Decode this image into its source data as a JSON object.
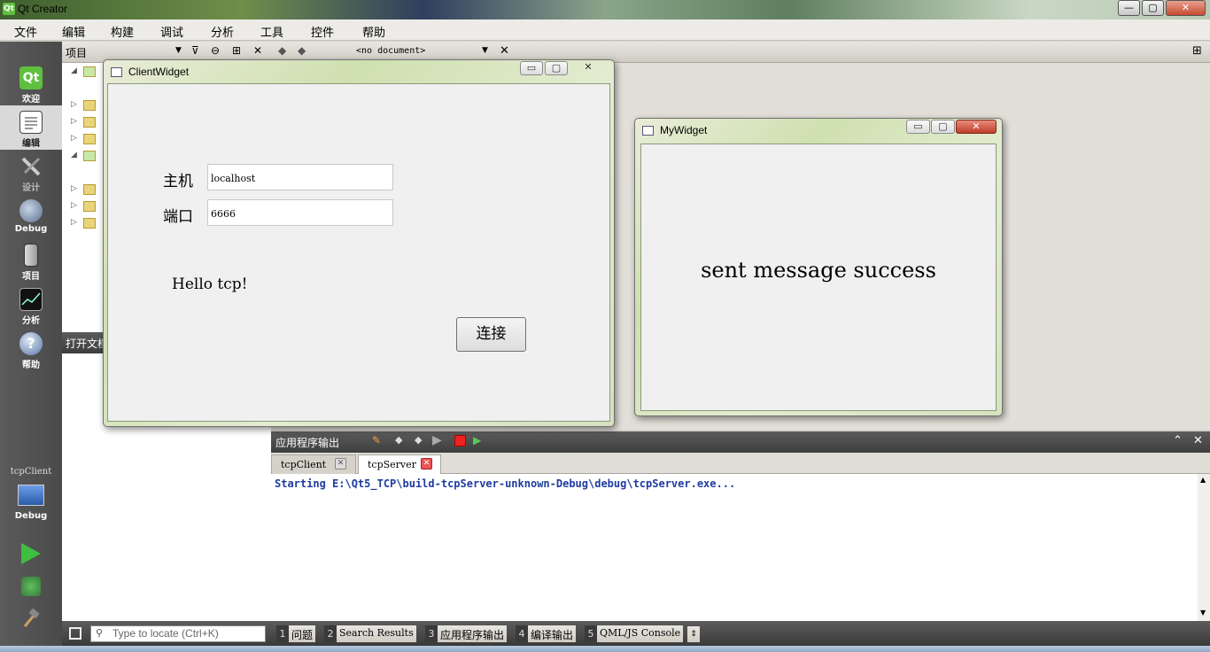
{
  "window": {
    "title": "Qt Creator",
    "minimize": "—",
    "maximize": "▢",
    "close": "✕"
  },
  "menubar": [
    "文件",
    "编辑",
    "构建",
    "调试",
    "分析",
    "工具",
    "控件",
    "帮助"
  ],
  "modes": [
    {
      "label": "欢迎",
      "icon": "qt-logo-icon"
    },
    {
      "label": "编辑",
      "icon": "edit-document-icon"
    },
    {
      "label": "设计",
      "icon": "design-tools-icon"
    },
    {
      "label": "Debug",
      "icon": "debug-icon"
    },
    {
      "label": "项目",
      "icon": "project-icon"
    },
    {
      "label": "分析",
      "icon": "analyze-icon"
    },
    {
      "label": "帮助",
      "icon": "help-icon"
    }
  ],
  "kit": {
    "project": "tcpClient",
    "build": "Debug"
  },
  "project_panel": {
    "title": "项目",
    "open_docs_title": "打开文档"
  },
  "editor_toolbar": {
    "document": "<no document>"
  },
  "output": {
    "title": "应用程序输出",
    "tabs": [
      {
        "label": "tcpClient"
      },
      {
        "label": "tcpServer"
      }
    ],
    "text": "Starting E:\\Qt5_TCP\\build-tcpServer-unknown-Debug\\debug\\tcpServer.exe..."
  },
  "statusbar": {
    "locate_placeholder": "Type to locate (Ctrl+K)",
    "buttons": [
      {
        "n": "1",
        "label": "问题"
      },
      {
        "n": "2",
        "label": "Search Results"
      },
      {
        "n": "3",
        "label": "应用程序输出"
      },
      {
        "n": "4",
        "label": "编译输出"
      },
      {
        "n": "5",
        "label": "QML/JS Console"
      }
    ]
  },
  "client_widget": {
    "title": "ClientWidget",
    "host_label": "主机",
    "host_value": "localhost",
    "port_label": "端口",
    "port_value": "6666",
    "message": "Hello tcp!",
    "connect_button": "连接"
  },
  "my_widget": {
    "title": "MyWidget",
    "message": "sent message success"
  }
}
